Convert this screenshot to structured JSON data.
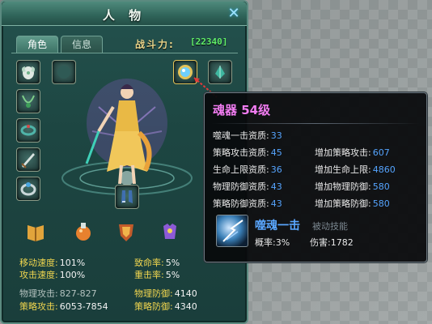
{
  "panel": {
    "title": "人 物",
    "close_icon": "close-icon",
    "tabs": [
      {
        "label": "角色",
        "active": true
      },
      {
        "label": "信息",
        "active": false
      }
    ],
    "combat_power_label": "战斗力:",
    "combat_power_value": "[22340]"
  },
  "equipment": {
    "left_slots": [
      "wing-egg-icon",
      "necklace-icon",
      "bracelet-icon",
      "sword-icon",
      "ring-icon"
    ],
    "top_slots": [
      "empty-slot",
      "soul-orb-icon",
      "gem-icon"
    ],
    "bottom_slots": [
      "boots-icon"
    ]
  },
  "emblems": [
    "book-icon",
    "potion-icon",
    "shield-icon",
    "armor-icon"
  ],
  "stats": {
    "move_speed_label": "移动速度:",
    "move_speed": "101%",
    "attack_speed_label": "攻击速度:",
    "attack_speed": "100%",
    "crit_rate_label": "致命率:",
    "crit_rate": "5%",
    "heavy_hit_label": "重击率:",
    "heavy_hit": "5%",
    "phys_attack_label": "物理攻击:",
    "phys_attack": "827-827",
    "strat_attack_label": "策略攻击:",
    "strat_attack": "6053-7854",
    "phys_def_label": "物理防御:",
    "phys_def": "4140",
    "strat_def_label": "策略防御:",
    "strat_def": "4340"
  },
  "tooltip": {
    "title": "魂器  54级",
    "rows_left": [
      {
        "label": "噬魂一击资质:",
        "value": "33"
      },
      {
        "label": "策略攻击资质:",
        "value": "45"
      },
      {
        "label": "生命上限资质:",
        "value": "36"
      },
      {
        "label": "物理防御资质:",
        "value": "43"
      },
      {
        "label": "策略防御资质:",
        "value": "43"
      }
    ],
    "rows_right": [
      {
        "label": "增加策略攻击:",
        "value": "607"
      },
      {
        "label": "增加生命上限:",
        "value": "4860"
      },
      {
        "label": "增加物理防御:",
        "value": "580"
      },
      {
        "label": "增加策略防御:",
        "value": "580"
      }
    ],
    "skill_name": "噬魂一击",
    "skill_type": "被动技能",
    "skill_prob_label": "概率:",
    "skill_prob": "3%",
    "skill_dmg_label": "伤害:",
    "skill_dmg": "1782"
  },
  "colors": {
    "panel_bg": "#1f4a46",
    "accent_yellow": "#f1d64f",
    "power_green": "#61f06a",
    "tooltip_title": "#f17cf1",
    "tooltip_value_blue": "#55a4ff"
  }
}
